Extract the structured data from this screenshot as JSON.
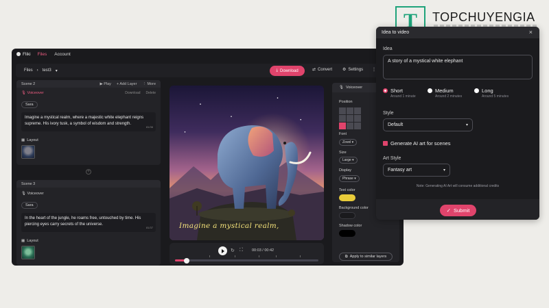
{
  "watermark": {
    "letter": "T",
    "text": "TOPCHUYENGIA"
  },
  "app": {
    "logo": "Fliki",
    "nav": [
      "Files",
      "Account"
    ],
    "breadcrumb": [
      "Files",
      "test3"
    ],
    "toolbar": {
      "download": "Download",
      "convert": "Convert",
      "settings": "Settings"
    },
    "scenes": [
      {
        "title": "Scene 2",
        "actions": [
          "Play",
          "Add Layer",
          "More"
        ],
        "voiceover_label": "Voiceover",
        "vo_actions": [
          "Download",
          "Delete"
        ],
        "voice": "Sara",
        "text": "Imagine a mystical realm, where a majestic white elephant reigns supreme. His ivory tusk, a symbol of wisdom and strength.",
        "count": "81/36",
        "layout_label": "Layout"
      },
      {
        "title": "Scene 3",
        "voiceover_label": "Voiceover",
        "voice": "Sara",
        "text": "In the heart of the jungle, he roams free, untouched by time. His piercing eyes carry secrets of the universe.",
        "count": "81/37",
        "layout_label": "Layout"
      }
    ],
    "preview_caption": "Imagine a mystical realm,",
    "player": {
      "time": "00:03 / 00:42",
      "progress": 0.08
    },
    "props": {
      "title": "Voiceover",
      "position_label": "Position",
      "position_selected": 6,
      "font_label": "Font",
      "font_value": "Zovel",
      "size_label": "Size",
      "size_value": "Large",
      "display_label": "Display",
      "display_value": "Phrase",
      "text_color_label": "Text color",
      "text_color": "#e9cc3a",
      "bg_color_label": "Background color",
      "bg_color": "#1a1a1d",
      "shadow_color_label": "Shadow color",
      "shadow_color": "#000000",
      "apply_label": "Apply to similar layers"
    }
  },
  "modal": {
    "title": "Idea to video",
    "idea_label": "Idea",
    "idea_value": "A story of a mystical white elephant",
    "lengths": [
      {
        "label": "Short",
        "sub": "Around 1 minute",
        "selected": true
      },
      {
        "label": "Medium",
        "sub": "Around 2 minutes",
        "selected": false
      },
      {
        "label": "Long",
        "sub": "Around 5 minutes",
        "selected": false
      }
    ],
    "style_label": "Style",
    "style_value": "Default",
    "generate_label": "Generate AI art for scenes",
    "art_style_label": "Art Style",
    "art_style_value": "Fantasy art",
    "note": "Note: Generating AI Art will consume additional credits",
    "submit": "Submit"
  },
  "colors": {
    "accent": "#e0446c",
    "panel": "#1a1a1d"
  }
}
